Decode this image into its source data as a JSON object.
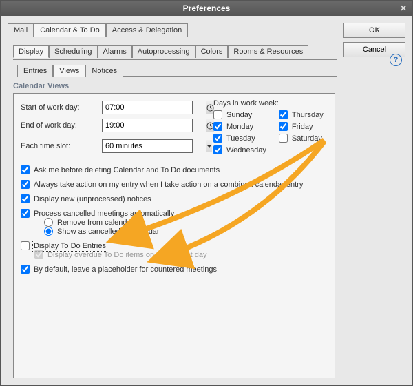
{
  "title": "Preferences",
  "buttons": {
    "ok": "OK",
    "cancel": "Cancel"
  },
  "tabs_top": {
    "mail": "Mail",
    "calendar": "Calendar & To Do",
    "access": "Access & Delegation"
  },
  "tabs_mid": {
    "display": "Display",
    "scheduling": "Scheduling",
    "alarms": "Alarms",
    "autoprocessing": "Autoprocessing",
    "colors": "Colors",
    "rooms": "Rooms & Resources"
  },
  "tabs_inner": {
    "entries": "Entries",
    "views": "Views",
    "notices": "Notices"
  },
  "section": "Calendar Views",
  "labels": {
    "start": "Start of work day:",
    "end": "End of work day:",
    "slot": "Each time slot:",
    "days_hdr": "Days in work week:"
  },
  "values": {
    "start": "07:00",
    "end": "19:00",
    "slot": "60 minutes"
  },
  "days": {
    "sunday": "Sunday",
    "monday": "Monday",
    "tuesday": "Tuesday",
    "wednesday": "Wednesday",
    "thursday": "Thursday",
    "friday": "Friday",
    "saturday": "Saturday"
  },
  "days_checked": {
    "sunday": false,
    "monday": true,
    "tuesday": true,
    "wednesday": true,
    "thursday": true,
    "friday": true,
    "saturday": false
  },
  "opts": {
    "ask_delete": "Ask me before deleting Calendar and To Do documents",
    "always_action": "Always take action on my entry when I take action on a combined calendar entry",
    "display_new": "Display new (unprocessed) notices",
    "process_cancelled": "Process cancelled meetings automatically",
    "remove": "Remove from calendar",
    "show_cancelled": "Show as cancelled in calendar",
    "display_todo": "Display To Do Entries",
    "display_overdue": "Display overdue To Do items on the current day",
    "placeholder": "By default, leave a placeholder for countered meetings"
  },
  "opts_checked": {
    "ask_delete": true,
    "always_action": true,
    "display_new": true,
    "process_cancelled": true,
    "display_todo": false,
    "display_overdue": true,
    "placeholder": true
  },
  "radio_selected": "show_cancelled",
  "colors": {
    "arrow": "#f5a623"
  }
}
